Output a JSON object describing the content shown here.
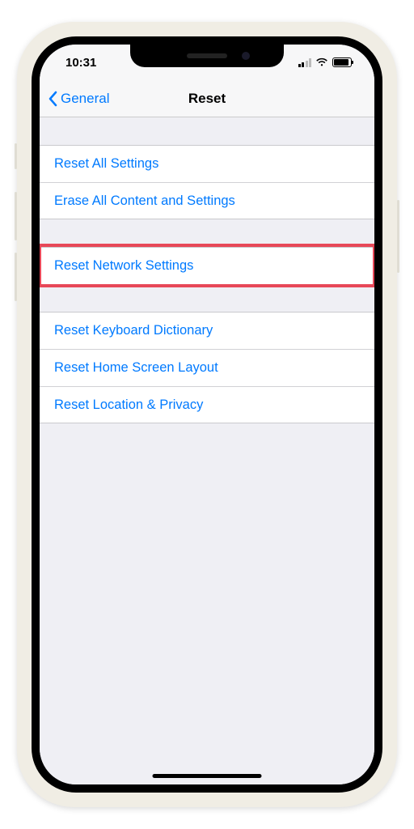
{
  "status": {
    "time": "10:31"
  },
  "nav": {
    "back_label": "General",
    "title": "Reset"
  },
  "groups": [
    {
      "items": [
        {
          "label": "Reset All Settings"
        },
        {
          "label": "Erase All Content and Settings"
        }
      ]
    },
    {
      "items": [
        {
          "label": "Reset Network Settings"
        }
      ]
    },
    {
      "items": [
        {
          "label": "Reset Keyboard Dictionary"
        },
        {
          "label": "Reset Home Screen Layout"
        },
        {
          "label": "Reset Location & Privacy"
        }
      ]
    }
  ]
}
